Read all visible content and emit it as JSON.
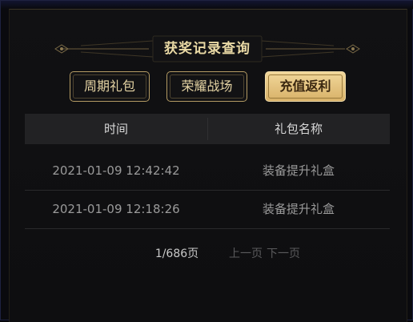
{
  "title": "获奖记录查询",
  "tabs": [
    {
      "label": "周期礼包",
      "active": false
    },
    {
      "label": "荣耀战场",
      "active": false
    },
    {
      "label": "充值返利",
      "active": true
    }
  ],
  "table": {
    "headers": [
      "时间",
      "礼包名称"
    ],
    "rows": [
      {
        "time": "2021-01-09 12:42:42",
        "name": "装备提升礼盒"
      },
      {
        "time": "2021-01-09 12:18:26",
        "name": "装备提升礼盒"
      }
    ]
  },
  "pagination": {
    "page_info": "1/686页",
    "prev_label": "上一页",
    "next_label": "下一页"
  },
  "colors": {
    "accent_gold": "#d8b168",
    "title_text": "#e9d9a5",
    "panel_bg": "#0e0e10"
  },
  "icons": [
    "title-ornament-left-icon",
    "title-ornament-right-icon"
  ]
}
